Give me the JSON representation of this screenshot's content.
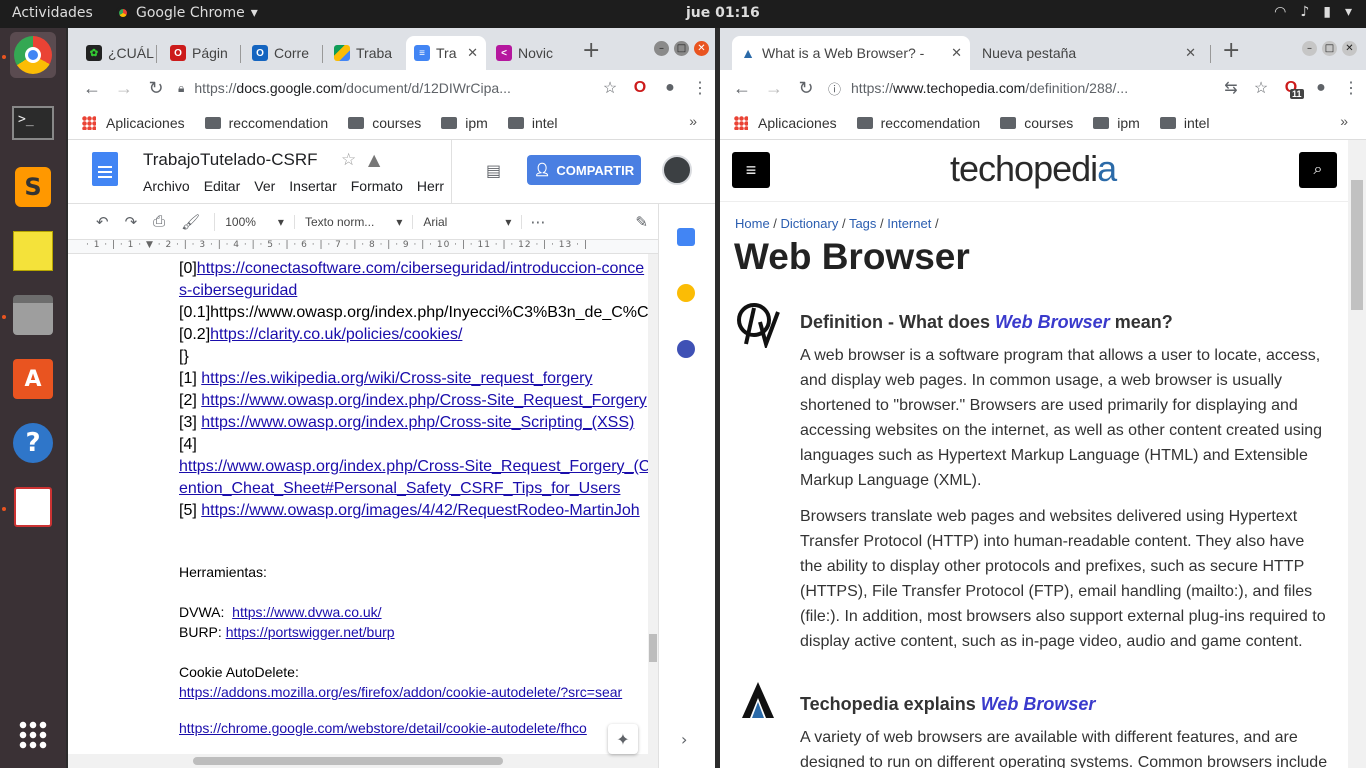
{
  "topbar": {
    "activities": "Actividades",
    "app_name": "Google Chrome",
    "clock": "jue 01:16"
  },
  "dock": {
    "items": [
      "chrome-icon",
      "terminal-icon",
      "sublime-icon",
      "notes-icon",
      "files-icon",
      "software-center-icon",
      "help-icon",
      "evince-icon",
      "apps-grid-icon"
    ]
  },
  "left_window": {
    "tabs": [
      {
        "label": "¿CUÁL",
        "color": "#222"
      },
      {
        "label": "Págin",
        "color": "#cc1b1b"
      },
      {
        "label": "Corre",
        "color": "#1565c0"
      },
      {
        "label": "Traba",
        "color": "#0f9d58"
      },
      {
        "label": "Tra",
        "color": "#4285f4"
      },
      {
        "label": "Novic",
        "color": "#b5179e"
      }
    ],
    "url_prefix": "https://",
    "url_domain": "docs.google.com",
    "url_path": "/document/d/12DIWrCipa...",
    "bookmarks": [
      "Aplicaciones",
      "reccomendation",
      "courses",
      "ipm",
      "intel"
    ],
    "doc": {
      "title": "TrabajoTutelado-CSRF",
      "menu": [
        "Archivo",
        "Editar",
        "Ver",
        "Insertar",
        "Formato",
        "Herr"
      ],
      "share_label": "COMPARTIR",
      "zoom": "100%",
      "style": "Texto norm...",
      "font": "Arial",
      "ruler": "· 1 · | · 1 · ▼ · 2 · | · 3 · | · 4 · | · 5 · | · 6 · | · 7 · | · 8 · | · 9 · | · 10 · | · 11 · | · 12 · | · 13 · |",
      "lines": [
        {
          "pre": "[0]",
          "link": "https://conectasoftware.com/ciberseguridad/introduccion-conce"
        },
        {
          "pre": "",
          "link": "s-ciberseguridad"
        },
        {
          "pre": "[0.1]https://www.owasp.org/index.php/Inyecci%C3%B3n_de_C%C",
          "link": ""
        },
        {
          "pre": "[0.2]",
          "link": "https://clarity.co.uk/policies/cookies/"
        },
        {
          "pre": "[}",
          "link": ""
        },
        {
          "pre": "[1] ",
          "link": "https://es.wikipedia.org/wiki/Cross-site_request_forgery"
        },
        {
          "pre": "[2] ",
          "link": "https://www.owasp.org/index.php/Cross-Site_Request_Forgery"
        },
        {
          "pre": "[3] ",
          "link": "https://www.owasp.org/index.php/Cross-site_Scripting_(XSS)"
        },
        {
          "pre": "[4]",
          "link": ""
        },
        {
          "pre": "",
          "link": "https://www.owasp.org/index.php/Cross-Site_Request_Forgery_(C"
        },
        {
          "pre": "",
          "link": "ention_Cheat_Sheet#Personal_Safety_CSRF_Tips_for_Users"
        },
        {
          "pre": "[5] ",
          "link": "https://www.owasp.org/images/4/42/RequestRodeo-MartinJoh"
        }
      ],
      "tools_heading": "Herramientas:",
      "dvwa_label": "DVWA:  ",
      "dvwa_link": "https://www.dvwa.co.uk/",
      "burp_label": "BURP: ",
      "burp_link": "https://portswigger.net/burp",
      "cookie_label": "Cookie AutoDelete:",
      "cookie_link": "https://addons.mozilla.org/es/firefox/addon/cookie-autodelete/?src=sear",
      "cutoff_link": "https://chrome.google.com/webstore/detail/cookie-autodelete/fhco"
    }
  },
  "right_window": {
    "tabs": [
      {
        "label": "What is a Web Browser? -"
      },
      {
        "label": "Nueva pestaña"
      }
    ],
    "url_prefix": "https://",
    "url_domain": "www.techopedia.com",
    "url_path": "/definition/288/...",
    "badge": "11",
    "bookmarks": [
      "Aplicaciones",
      "reccomendation",
      "courses",
      "ipm",
      "intel"
    ],
    "page": {
      "logo_pre": "techopedi",
      "logo_a": "a",
      "breadcrumbs": [
        "Home",
        "Dictionary",
        "Tags",
        "Internet"
      ],
      "title": "Web Browser",
      "def_heading_pre": "Definition - What does ",
      "def_heading_em": "Web Browser",
      "def_heading_post": " mean?",
      "para1": "A web browser is a software program that allows a user to locate, access, and display web pages. In common usage, a web browser is usually shortened to \"browser.\" Browsers are used primarily for displaying and accessing websites on the internet, as well as other content created using languages such as Hypertext Markup Language (HTML) and Extensible Markup Language (XML).",
      "para2": "Browsers translate web pages and websites delivered using Hypertext Transfer Protocol (HTTP) into human-readable content. They also have the ability to display other protocols and prefixes, such as secure HTTP (HTTPS), File Transfer Protocol (FTP), email handling (mailto:), and files (file:). In addition, most browsers also support external plug-ins required to display active content, such as in-page video, audio and game content.",
      "explains_pre": "Techopedia explains ",
      "explains_em": "Web Browser",
      "para3": "A variety of web browsers are available with different features, and are designed to run on different operating systems. Common browsers include"
    }
  },
  "colors": {
    "ubuntu_orange": "#e95420",
    "docs_blue": "#4285f4",
    "link": "#1a0dab"
  }
}
